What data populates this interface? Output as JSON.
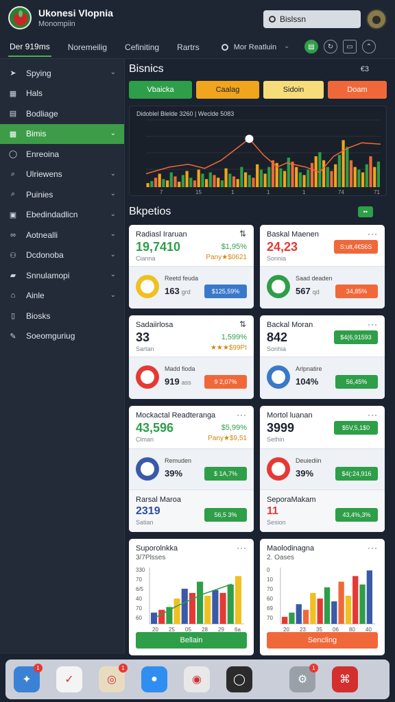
{
  "header": {
    "title": "Ukonesi Vlopnia",
    "subtitle": "Monompiin",
    "search_text": "Bislssn"
  },
  "tabs": [
    "Der 919ms",
    "Noremeilig",
    "Cefiniting",
    "Rartrs"
  ],
  "tab_search": "Mor Reatluin",
  "sidebar": {
    "items": [
      {
        "label": "Spying",
        "icon": "tag-icon",
        "chevron": true,
        "active": false
      },
      {
        "label": "Hals",
        "icon": "grid-icon",
        "chevron": false,
        "active": false
      },
      {
        "label": "Bodliage",
        "icon": "table-icon",
        "chevron": false,
        "active": false
      },
      {
        "label": "Bimis",
        "icon": "sheet-icon",
        "chevron": true,
        "active": true
      },
      {
        "label": "Enreoina",
        "icon": "user-icon",
        "chevron": false,
        "active": false
      },
      {
        "label": "Ulriewens",
        "icon": "search-icon",
        "chevron": true,
        "active": false
      },
      {
        "label": "Puinies",
        "icon": "search-icon",
        "chevron": true,
        "active": false
      },
      {
        "label": "Ebedindadlicn",
        "icon": "chart-icon",
        "chevron": true,
        "active": false
      },
      {
        "label": "Aotnealli",
        "icon": "link-icon",
        "chevron": true,
        "active": false
      },
      {
        "label": "Dcdonoba",
        "icon": "people-icon",
        "chevron": true,
        "active": false
      },
      {
        "label": "Snnulamopi",
        "icon": "box-icon",
        "chevron": true,
        "active": false
      },
      {
        "label": "Ainle",
        "icon": "home-icon",
        "chevron": true,
        "active": false
      },
      {
        "label": "Biosks",
        "icon": "book-icon",
        "chevron": false,
        "active": false
      },
      {
        "label": "Soeomguriug",
        "icon": "edit-icon",
        "chevron": false,
        "active": false
      }
    ]
  },
  "section": {
    "title": "Bisnics",
    "meta": "€3",
    "pills": [
      {
        "label": "Vbaicka",
        "color": "#2e9e49"
      },
      {
        "label": "Caalag",
        "color": "#f0a51c"
      },
      {
        "label": "Sidoin",
        "color": "#f7dd7a"
      },
      {
        "label": "Doam",
        "color": "#f0683a"
      }
    ]
  },
  "main_chart": {
    "legend": "Didoblel Blelde  3260  |  Weclde  5083",
    "tick_labels": [
      "7",
      "15",
      "1",
      "1",
      "1",
      "74",
      "71"
    ]
  },
  "grid_head": {
    "title": "Bkpetios",
    "button": "••"
  },
  "cards": [
    {
      "title": "Radiasl Iraruan",
      "value": "19,7410",
      "value_color": "#2e9e49",
      "sub": "Cianna",
      "pct": "$1,95%",
      "detail": "Pany★$0621",
      "b_label": "Reetd feuda",
      "b_value": "163",
      "b_unit": "grd",
      "b_button": "$125,59%",
      "b_btn_color": "#3a78c9",
      "circle": "#f0c020"
    },
    {
      "title": "Baskal Maenen",
      "value": "24,23",
      "value_color": "#e53935",
      "sub": "Sonnia",
      "r_button": "S:ult,4€56S",
      "r_btn_color": "#f0683a",
      "b_label": "Saad deaden",
      "b_value": "567",
      "b_unit": "qd",
      "b_button": "34,85%",
      "b_btn_color": "#f0683a",
      "circle": "#2e9e49"
    },
    {
      "title": "Sadaiirlosa",
      "value": "33",
      "value_color": "#1c2230",
      "sub": "Sartan",
      "pct": "1,599%",
      "detail": "★★★$99PI",
      "b_label": "Madd fioda",
      "b_value": "919",
      "b_unit": "ass",
      "b_button": "9 2,07%",
      "b_btn_color": "#f0683a",
      "circle": "#e53935"
    },
    {
      "title": "Backal Moran",
      "value": "842",
      "value_color": "#1c2230",
      "sub": "Sonhia",
      "r_button": "$4(6,91593",
      "r_btn_color": "#2e9e49",
      "b_label": "Arlpnatire",
      "b_value": "104%",
      "b_unit": "",
      "b_button": "56,45%",
      "b_btn_color": "#2e9e49",
      "circle": "#3a78c9"
    },
    {
      "title": "Mockactal Readteranga",
      "value": "43,596",
      "value_color": "#2e9e49",
      "sub": "Clman",
      "pct": "$5,99%",
      "detail": "Pany★$9,51",
      "b_label": "Remuden",
      "b_value": "39%",
      "b_unit": "",
      "b_button": "$ 1A,7%",
      "b_btn_color": "#2e9e49",
      "circle": "#3a5aa8",
      "f_title": "Rarsal Maroa",
      "f_value": "2319",
      "f_value_color": "#2a4d9c",
      "f_sub": "Satian",
      "f_button": "56,5 3%",
      "f_btn_color": "#2e9e49"
    },
    {
      "title": "Mortol luanan",
      "value": "3999",
      "value_color": "#1c2230",
      "sub": "Sethin",
      "r_button": "$5V,5,1$0",
      "r_btn_color": "#2e9e49",
      "b_label": "Deuiediin",
      "b_value": "39%",
      "b_unit": "",
      "b_button": "$4(:24,916",
      "b_btn_color": "#2e9e49",
      "circle": "#e53935",
      "f_title": "SeporaMakam",
      "f_value": "11",
      "f_value_color": "#e53935",
      "f_sub": "Sesion",
      "f_button": "43,4%,3%",
      "f_btn_color": "#2e9e49"
    },
    {
      "title": "Suporolnkka",
      "sub2": "3/7Plsses",
      "button": "Bellain",
      "btn_color": "#2e9e49",
      "ticks": [
        "20",
        "25",
        "05",
        "28",
        "29",
        "6a"
      ],
      "yticks": [
        "330",
        "70",
        "6/5",
        "40",
        "70",
        "60"
      ]
    },
    {
      "title": "Maolodinagna",
      "sub2": "2. Oases",
      "button": "Sencling",
      "btn_color": "#f0683a",
      "ticks": [
        "20",
        "23",
        "35",
        "06",
        "80",
        "40"
      ],
      "yticks": [
        "0",
        "10",
        "70",
        "60",
        "69",
        "70"
      ]
    }
  ],
  "chart_data": [
    {
      "type": "bar",
      "title": "",
      "categories": [
        "1",
        "2",
        "3",
        "4",
        "5",
        "6",
        "7",
        "8",
        "9",
        "10",
        "11",
        "12",
        "13",
        "14",
        "15",
        "16",
        "17",
        "18",
        "19",
        "20",
        "21",
        "22",
        "23",
        "24",
        "25",
        "26",
        "27",
        "28",
        "29",
        "30",
        "31",
        "32",
        "33",
        "34",
        "35",
        "36",
        "37",
        "38",
        "39",
        "40",
        "41",
        "42",
        "43",
        "44",
        "45",
        "46",
        "47",
        "48",
        "49",
        "50",
        "51",
        "52",
        "53",
        "54",
        "55",
        "56",
        "57",
        "58",
        "59",
        "60"
      ],
      "series": [
        {
          "name": "",
          "values": [
            6,
            9,
            14,
            20,
            12,
            10,
            22,
            16,
            8,
            18,
            24,
            14,
            10,
            26,
            20,
            12,
            22,
            18,
            14,
            10,
            28,
            20,
            16,
            12,
            30,
            22,
            18,
            14,
            34,
            26,
            20,
            30,
            40,
            36,
            28,
            24,
            44,
            38,
            30,
            22,
            18,
            26,
            36,
            46,
            52,
            40,
            30,
            24,
            34,
            48,
            70,
            60,
            40,
            30,
            26,
            22,
            34,
            46,
            30,
            38
          ]
        }
      ],
      "line": [
        {
          "x": 0,
          "y": 20
        },
        {
          "x": 10,
          "y": 30
        },
        {
          "x": 18,
          "y": 34
        },
        {
          "x": 25,
          "y": 28
        },
        {
          "x": 32,
          "y": 40
        },
        {
          "x": 38,
          "y": 56
        },
        {
          "x": 44,
          "y": 72
        },
        {
          "x": 50,
          "y": 48
        },
        {
          "x": 56,
          "y": 30
        },
        {
          "x": 60,
          "y": 36
        },
        {
          "x": 68,
          "y": 30
        },
        {
          "x": 74,
          "y": 22
        },
        {
          "x": 80,
          "y": 46
        },
        {
          "x": 86,
          "y": 58
        },
        {
          "x": 92,
          "y": 66
        },
        {
          "x": 100,
          "y": 64
        }
      ],
      "ylim": [
        0,
        100
      ]
    },
    {
      "type": "bar",
      "title": "Suporolnkka",
      "categories": [
        "20",
        "25",
        "05",
        "28",
        "29",
        "6a"
      ],
      "series": [
        {
          "name": "",
          "values": [
            8,
            10,
            12,
            18,
            25,
            22,
            30,
            20,
            24,
            22,
            28,
            34
          ]
        }
      ],
      "ylim": [
        0,
        40
      ]
    },
    {
      "type": "bar",
      "title": "Maolodinagna",
      "categories": [
        "20",
        "23",
        "35",
        "06",
        "80",
        "40"
      ],
      "series": [
        {
          "name": "",
          "values": [
            5,
            8,
            14,
            10,
            22,
            18,
            26,
            16,
            30,
            20,
            34,
            28,
            38
          ]
        }
      ],
      "ylim": [
        0,
        40
      ]
    }
  ],
  "dock": {
    "apps": [
      {
        "name": "safari-icon",
        "color": "#3b82d6",
        "badge": "1"
      },
      {
        "name": "calendar-icon",
        "color": "#f4f4f4",
        "badge": ""
      },
      {
        "name": "photos-icon",
        "color": "#e8dcc0",
        "badge": "1"
      },
      {
        "name": "mail-icon",
        "color": "#2f8ef0",
        "badge": ""
      },
      {
        "name": "chrome-icon",
        "color": "#e8e8e8",
        "badge": ""
      },
      {
        "name": "camera-icon",
        "color": "#2b2b2b",
        "badge": ""
      },
      {
        "name": "settings-icon",
        "color": "#9aa0a8",
        "badge": "1"
      },
      {
        "name": "acrobat-icon",
        "color": "#d32f2f",
        "badge": ""
      }
    ]
  }
}
